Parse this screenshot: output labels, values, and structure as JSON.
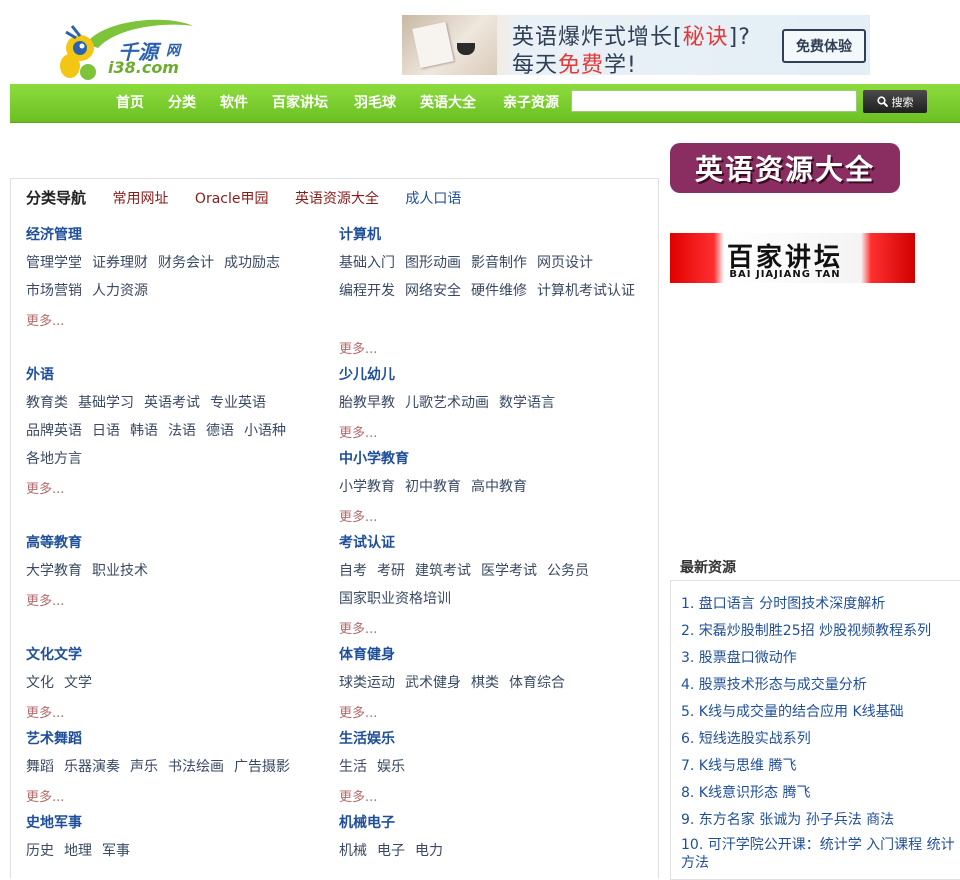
{
  "logo": {
    "main_text": "千源",
    "sub_text": "i38.com",
    "alt": "网"
  },
  "banner": {
    "line1_a": "英语爆炸式增长",
    "line1_b": "[",
    "line1_red": "秘诀",
    "line1_c": "]?",
    "line2_a": "每天",
    "line2_red": "免费",
    "line2_b": "学!",
    "cta": "免费体验"
  },
  "nav": {
    "items": [
      "首页",
      "分类",
      "软件",
      "百家讲坛",
      "羽毛球",
      "英语大全",
      "亲子资源"
    ],
    "search_value": "",
    "search_button": "搜索"
  },
  "panel": {
    "title": "分类导航",
    "links": [
      "常用网址",
      "Oracle甲园",
      "英语资源大全",
      "成人口语"
    ]
  },
  "categories": {
    "more": "更多...",
    "jjgl": {
      "title": "经济管理",
      "row1": [
        "管理学堂",
        "证券理财",
        "财务会计",
        "成功励志"
      ],
      "row2": [
        "市场营销",
        "人力资源"
      ]
    },
    "jsj": {
      "title": "计算机",
      "row1": [
        "基础入门",
        "图形动画",
        "影音制作",
        "网页设计"
      ],
      "row2": [
        "编程开发",
        "网络安全",
        "硬件维修",
        "计算机考试认证"
      ]
    },
    "wy": {
      "title": "外语",
      "row1": [
        "教育类",
        "基础学习",
        "英语考试",
        "专业英语"
      ],
      "row2": [
        "品牌英语",
        "日语",
        "韩语",
        "法语",
        "德语",
        "小语种"
      ],
      "row3": [
        "各地方言"
      ]
    },
    "seye": {
      "title": "少儿幼儿",
      "row1": [
        "胎教早教",
        "儿歌艺术动画",
        "数学语言"
      ]
    },
    "zxx": {
      "title": "中小学教育",
      "row1": [
        "小学教育",
        "初中教育",
        "高中教育"
      ]
    },
    "gdjy": {
      "title": "高等教育",
      "row1": [
        "大学教育",
        "职业技术"
      ]
    },
    "ksrz": {
      "title": "考试认证",
      "row1": [
        "自考",
        "考研",
        "建筑考试",
        "医学考试",
        "公务员"
      ],
      "row2": [
        "国家职业资格培训"
      ]
    },
    "whwx": {
      "title": "文化文学",
      "row1": [
        "文化",
        "文学"
      ]
    },
    "tyjs": {
      "title": "体育健身",
      "row1": [
        "球类运动",
        "武术健身",
        "棋类",
        "体育综合"
      ]
    },
    "yswd": {
      "title": "艺术舞蹈",
      "row1": [
        "舞蹈",
        "乐器演奏",
        "声乐",
        "书法绘画",
        "广告摄影"
      ]
    },
    "shyl": {
      "title": "生活娱乐",
      "row1": [
        "生活",
        "娱乐"
      ]
    },
    "sdjs": {
      "title": "史地军事",
      "row1": [
        "历史",
        "地理",
        "军事"
      ]
    },
    "jxdz": {
      "title": "机械电子",
      "row1": [
        "机械",
        "电子",
        "电力"
      ]
    }
  },
  "right": {
    "banner1": "英语资源大全",
    "banner2_title": "百家讲坛",
    "banner2_sub": "BAI JIAJIANG TAN",
    "latest_title": "最新资源",
    "latest": [
      "1. 盘口语言 分时图技术深度解析",
      "2. 宋磊炒股制胜25招 炒股视频教程系列",
      "3. 股票盘口微动作",
      "4. 股票技术形态与成交量分析",
      "5. K线与成交量的结合应用 K线基础",
      "6. 短线选股实战系列",
      "7. K线与思维 腾飞",
      "8. K线意识形态 腾飞",
      "9. 东方名家 张诚为 孙子兵法 商法",
      "10. 可汗学院公开课：统计学 入门课程 统计方法"
    ]
  },
  "colors": {
    "nav_green": "#7acd2e",
    "link_blue": "#1f4f9a",
    "link_red": "#8b1a1a",
    "more": "#b36a6a"
  }
}
